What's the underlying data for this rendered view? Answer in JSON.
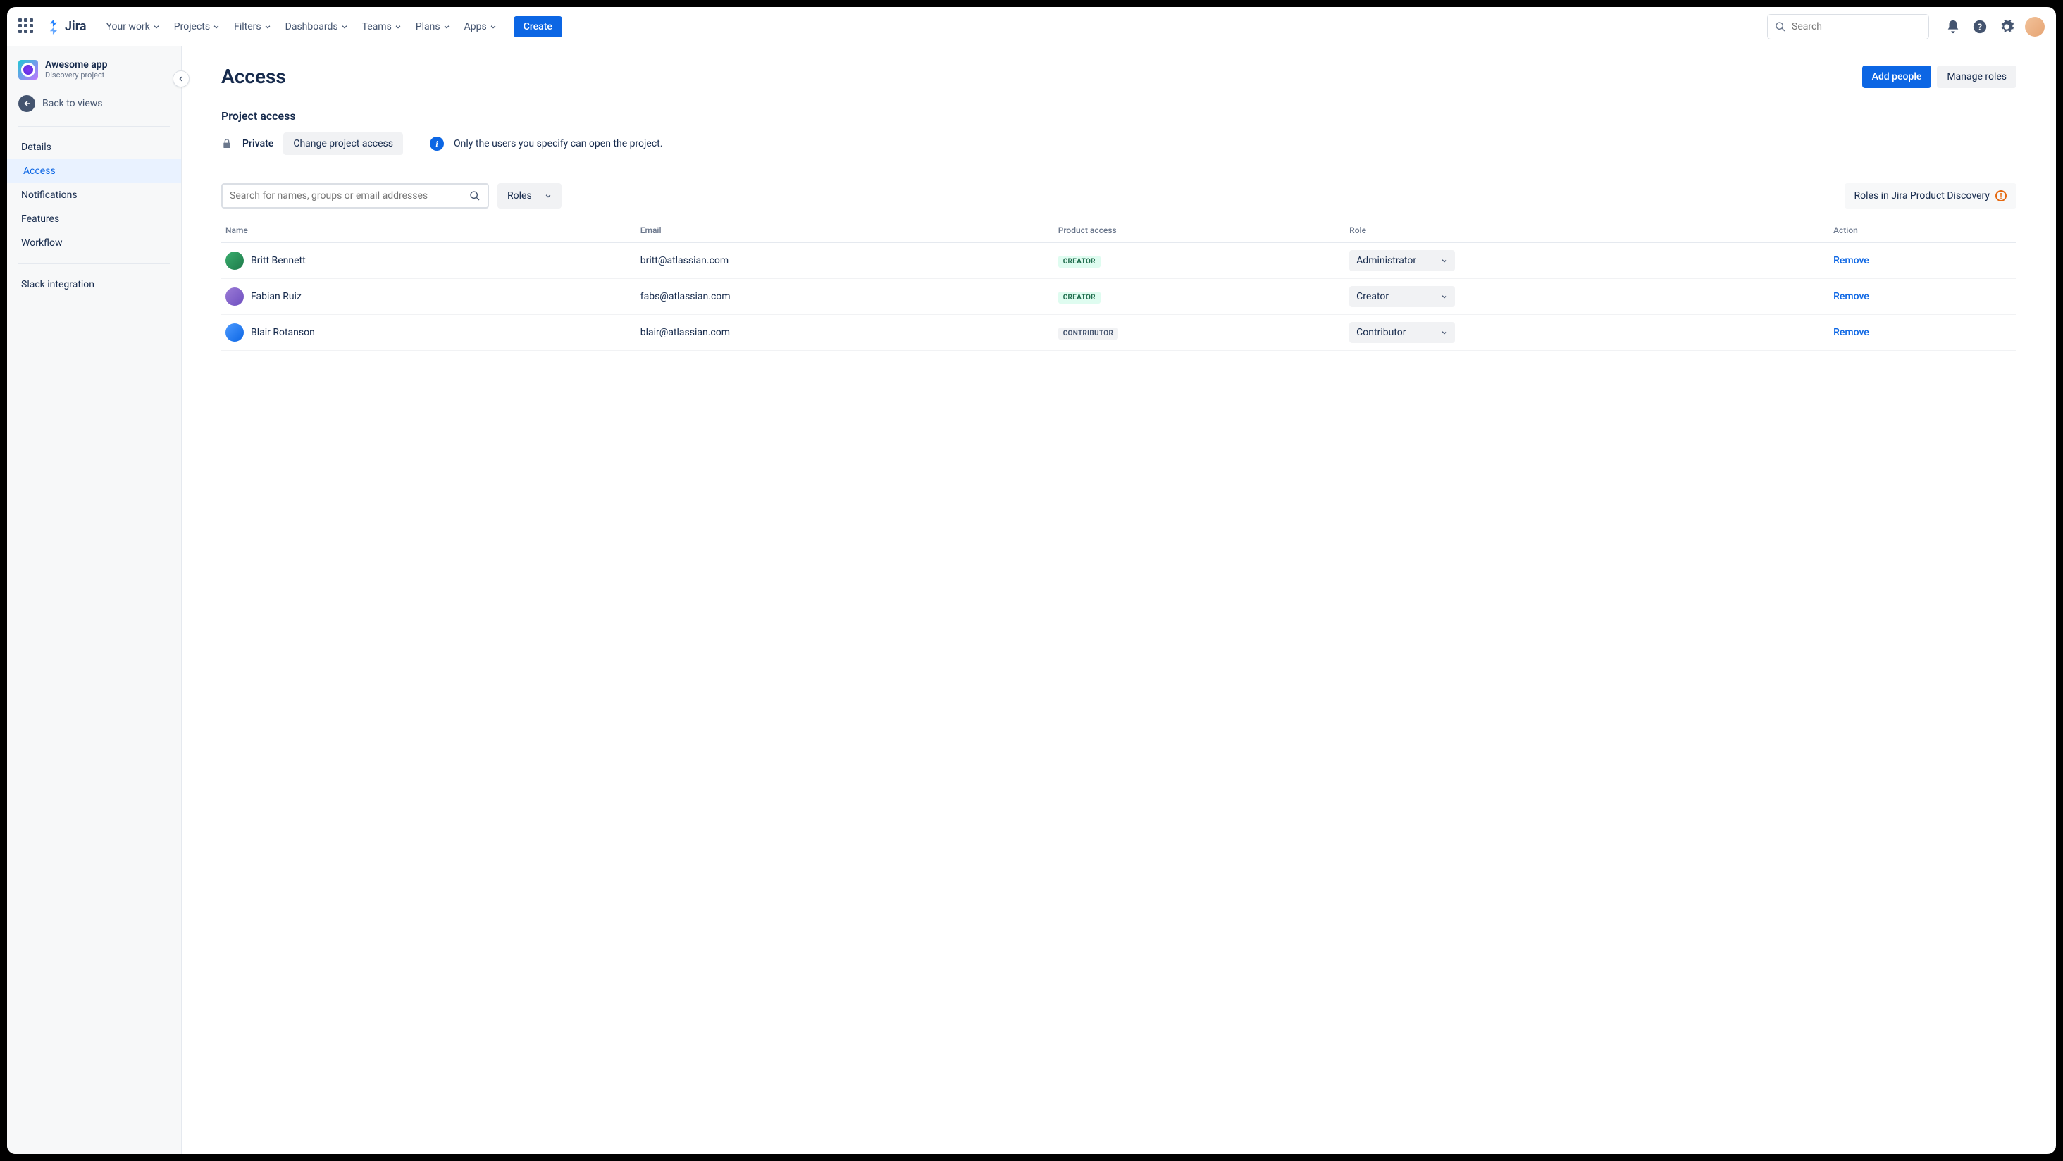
{
  "topnav": {
    "product": "Jira",
    "items": [
      "Your work",
      "Projects",
      "Filters",
      "Dashboards",
      "Teams",
      "Plans",
      "Apps"
    ],
    "create": "Create",
    "search_placeholder": "Search"
  },
  "sidebar": {
    "project_name": "Awesome app",
    "project_type": "Discovery project",
    "back": "Back to views",
    "items": [
      "Details",
      "Access",
      "Notifications",
      "Features",
      "Workflow"
    ],
    "active_index": 1,
    "footer_item": "Slack integration"
  },
  "page": {
    "title": "Access",
    "add_people": "Add people",
    "manage_roles": "Manage roles",
    "section": "Project access",
    "privacy": "Private",
    "change": "Change project access",
    "info": "Only the users you specify can open the project.",
    "search_placeholder": "Search for names, groups or email addresses",
    "roles_label": "Roles",
    "roles_help": "Roles in Jira Product Discovery"
  },
  "table": {
    "headers": {
      "name": "Name",
      "email": "Email",
      "product": "Product access",
      "role": "Role",
      "action": "Action"
    },
    "rows": [
      {
        "name": "Britt Bennett",
        "email": "britt@atlassian.com",
        "badge": "CREATOR",
        "badge_class": "badge-creator",
        "role": "Administrator",
        "action": "Remove",
        "avatar": "linear-gradient(135deg,#3AAE6E,#1E7A4A)"
      },
      {
        "name": "Fabian Ruiz",
        "email": "fabs@atlassian.com",
        "badge": "CREATOR",
        "badge_class": "badge-creator",
        "role": "Creator",
        "action": "Remove",
        "avatar": "linear-gradient(135deg,#9B7BD6,#6E4FC0)"
      },
      {
        "name": "Blair Rotanson",
        "email": "blair@atlassian.com",
        "badge": "CONTRIBUTOR",
        "badge_class": "badge-contrib",
        "role": "Contributor",
        "action": "Remove",
        "avatar": "linear-gradient(135deg,#4C9AFF,#0C66E4)"
      }
    ]
  }
}
